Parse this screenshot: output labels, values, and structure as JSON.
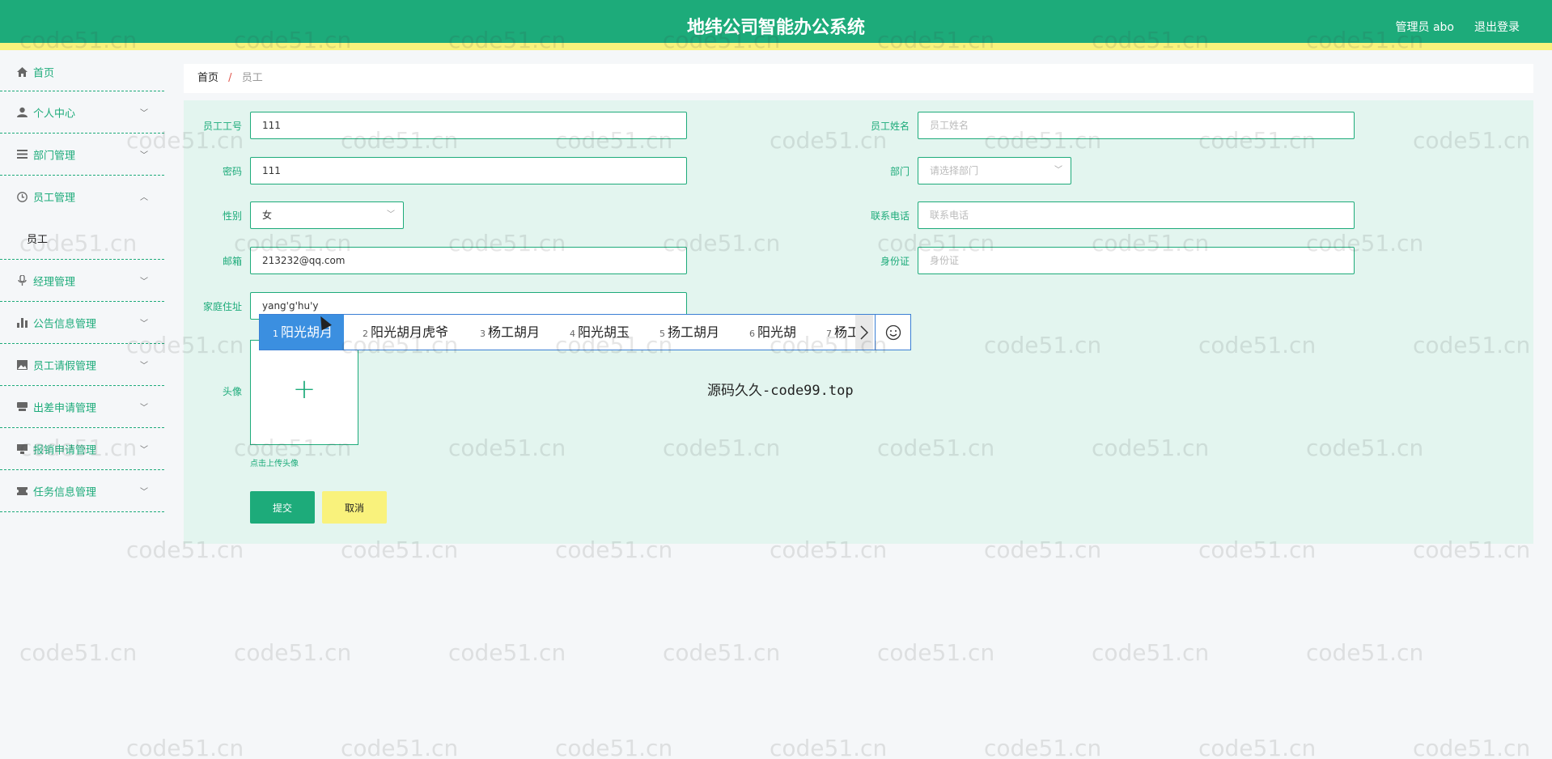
{
  "header": {
    "title": "地纬公司智能办公系统",
    "user": "管理员 abo",
    "logout": "退出登录",
    "accent_color": "#1dab7a",
    "accent_bar_color": "#f9f27c"
  },
  "sidebar": {
    "items": [
      {
        "label": "首页",
        "icon": "home-icon"
      },
      {
        "label": "个人中心",
        "icon": "user-icon"
      },
      {
        "label": "部门管理",
        "icon": "list-icon"
      },
      {
        "label": "员工管理",
        "icon": "clock-icon",
        "expanded": true,
        "sub": [
          "员工"
        ]
      },
      {
        "label": "经理管理",
        "icon": "mic-icon"
      },
      {
        "label": "公告信息管理",
        "icon": "bar-chart-icon"
      },
      {
        "label": "员工请假管理",
        "icon": "image-icon"
      },
      {
        "label": "出差申请管理",
        "icon": "drive-icon"
      },
      {
        "label": "报销申请管理",
        "icon": "monitor-icon"
      },
      {
        "label": "任务信息管理",
        "icon": "ticket-icon"
      }
    ]
  },
  "breadcrumb": {
    "home": "首页",
    "separator": "/",
    "current": "员工"
  },
  "form": {
    "emp_no_label": "员工工号",
    "emp_no_value": "111",
    "emp_name_label": "员工姓名",
    "emp_name_placeholder": "员工姓名",
    "password_label": "密码",
    "password_value": "111",
    "dept_label": "部门",
    "dept_placeholder": "请选择部门",
    "gender_label": "性别",
    "gender_value": "女",
    "phone_label": "联系电话",
    "phone_placeholder": "联系电话",
    "email_label": "邮箱",
    "email_value": "213232@qq.com",
    "idcard_label": "身份证",
    "idcard_placeholder": "身份证",
    "address_label": "家庭住址",
    "address_value": "yang'g'hu'y",
    "avatar_label": "头像",
    "avatar_hint": "点击上传头像",
    "submit": "提交",
    "cancel": "取消"
  },
  "ime": {
    "candidates": [
      {
        "num": "1",
        "text": "阳光胡月"
      },
      {
        "num": "2",
        "text": "阳光胡月虎爷"
      },
      {
        "num": "3",
        "text": "杨工胡月"
      },
      {
        "num": "4",
        "text": "阳光胡玉"
      },
      {
        "num": "5",
        "text": "扬工胡月"
      },
      {
        "num": "6",
        "text": "阳光胡"
      },
      {
        "num": "7",
        "text": "杨工"
      }
    ],
    "next_icon": "chevron-right-icon",
    "emoji_icon": "smiley-icon"
  },
  "overlay_text": "源码久久-code99.top",
  "watermark": "code51.cn"
}
